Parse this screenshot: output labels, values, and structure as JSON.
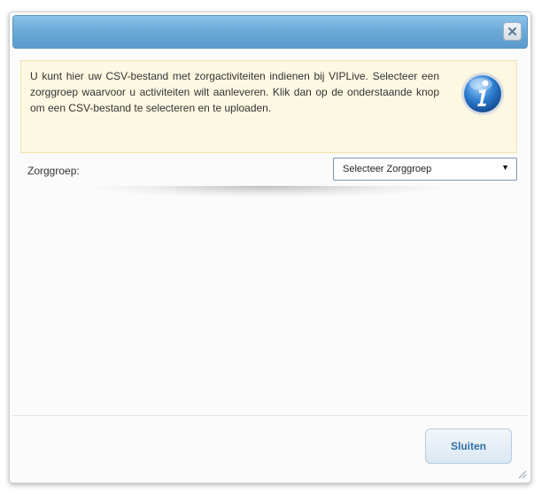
{
  "dialog": {
    "info": {
      "text": "U kunt hier uw CSV-bestand met zorgactiviteiten indienen bij VIPLive. Selecteer een zorggroep waarvoor u activiteiten wilt aanleveren. Klik dan op de onderstaande knop om een CSV-bestand te selecteren en te uploaden.",
      "icon": "info-icon"
    },
    "form": {
      "zorggroep_label": "Zorggroep:",
      "zorggroep_select": {
        "selected": "Selecteer Zorggroep"
      }
    },
    "footer": {
      "close_label": "Sluiten"
    },
    "icons": {
      "titlebar_close": "close-icon",
      "select_arrow": "chevron-down-icon",
      "resize": "resize-grip-icon"
    },
    "colors": {
      "titlebar": "#6aa8d7",
      "info_background": "#fdf8e2",
      "button_text": "#2f6ea6"
    }
  }
}
